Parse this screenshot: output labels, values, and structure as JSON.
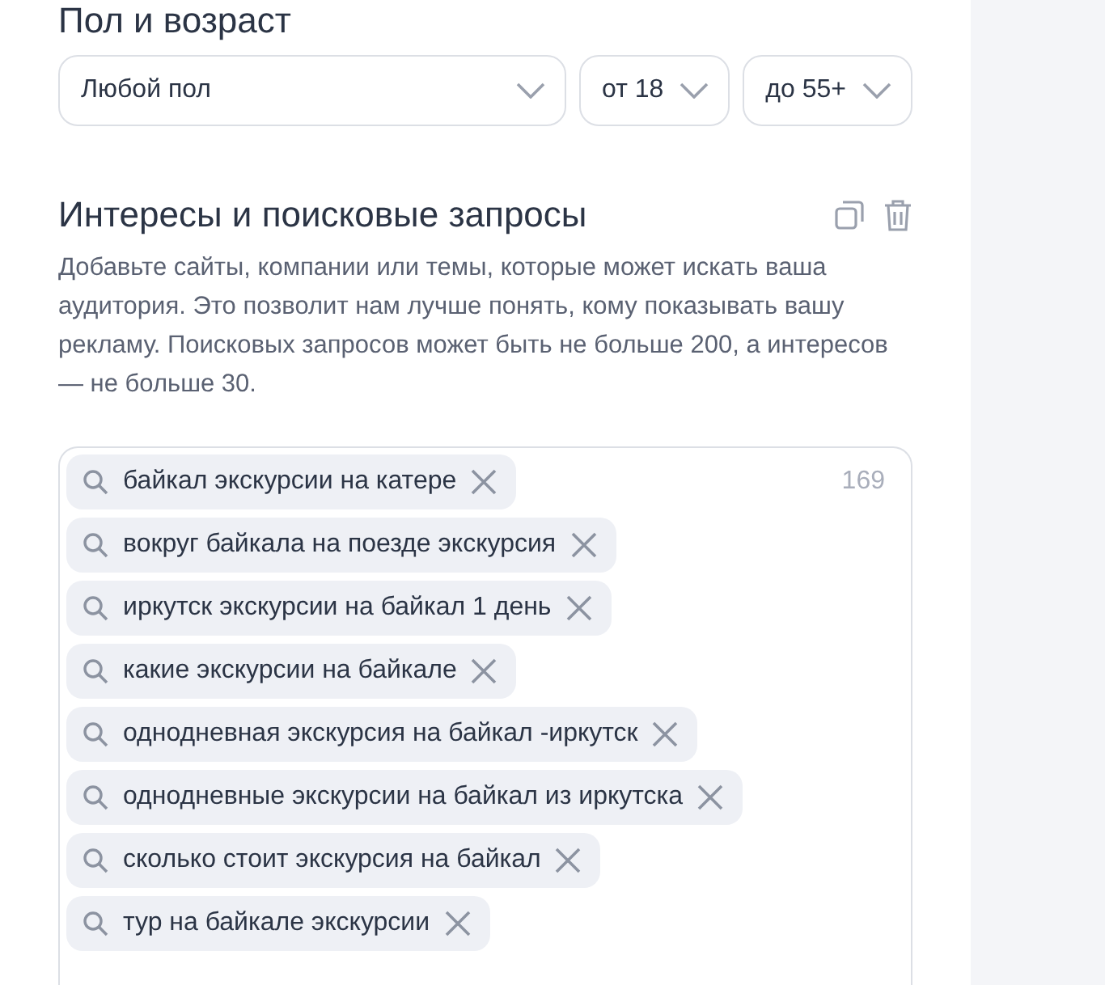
{
  "section_heading": "Пол и возраст",
  "selects": [
    {
      "kind": "gender",
      "value": "Любой пол"
    },
    {
      "kind": "age",
      "value": "от 18"
    },
    {
      "kind": "age",
      "value": "до 55+"
    }
  ],
  "interests": {
    "title": "Интересы и поисковые запросы",
    "description": "Добавьте сайты, компании или темы, которые может искать ваша аудитория. Это позволит нам лучше понять, кому показывать вашу рекламу. Поисковых запросов может быть не больше 200, а интересов — не больше 30.",
    "counter": "169",
    "chips": [
      {
        "label": "байкал экскурсии на катере"
      },
      {
        "label": "вокруг байкала на поезде экскурсия"
      },
      {
        "label": "иркутск экскурсии на байкал 1 день"
      },
      {
        "label": "какие экскурсии на байкале"
      },
      {
        "label": "однодневная экскурсия на байкал -иркутск"
      },
      {
        "label": "однодневные экскурсии на байкал из иркутска"
      },
      {
        "label": "сколько стоит экскурсия на байкал"
      },
      {
        "label": "тур на байкале экскурсии"
      }
    ]
  }
}
